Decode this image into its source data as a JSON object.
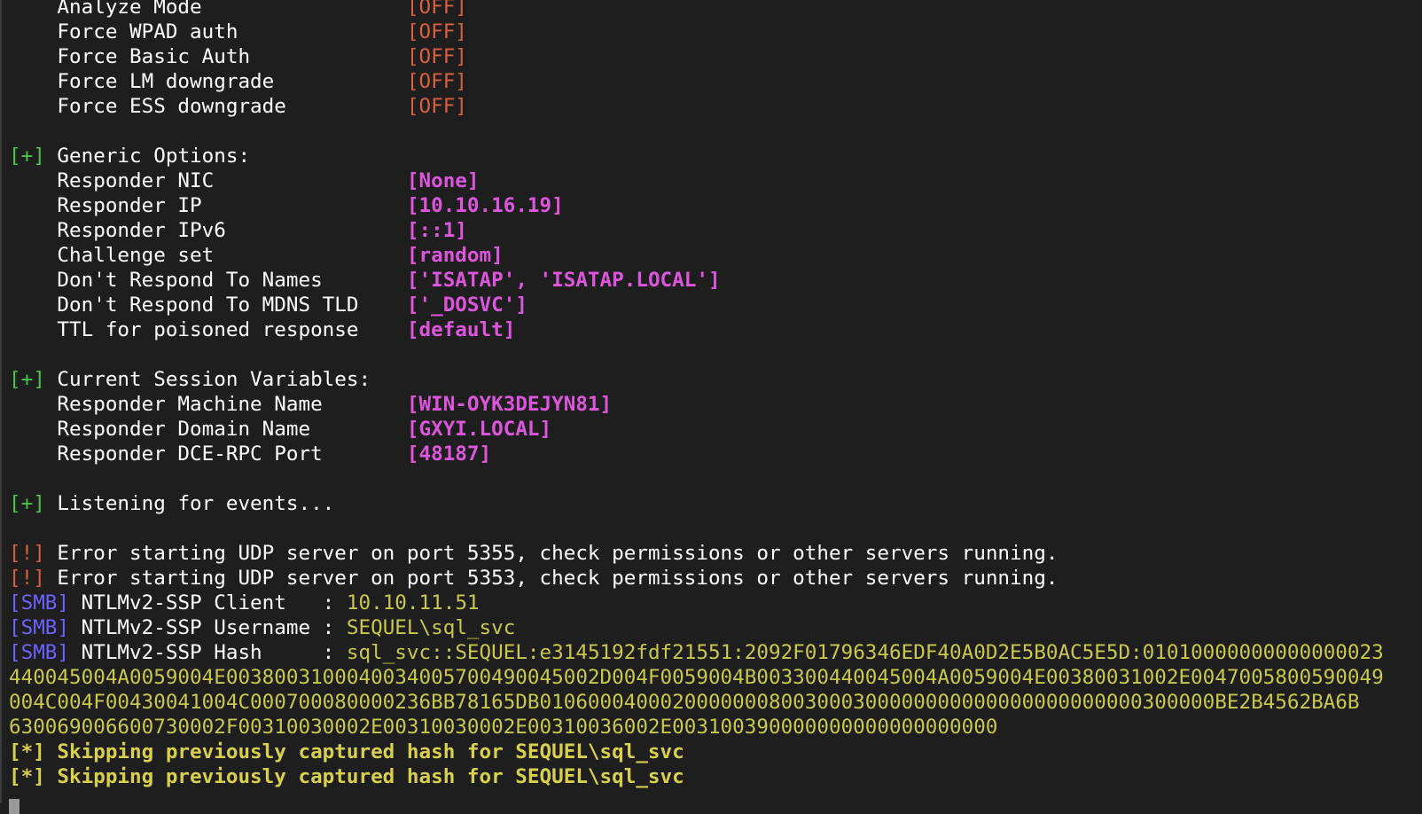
{
  "terminal": {
    "lines": [
      {
        "segments": [
          {
            "text": "    Analyze Mode                 ",
            "color": "white"
          },
          {
            "text": "[OFF]",
            "color": "red"
          }
        ]
      },
      {
        "segments": [
          {
            "text": "    Force WPAD auth              ",
            "color": "white"
          },
          {
            "text": "[OFF]",
            "color": "red"
          }
        ]
      },
      {
        "segments": [
          {
            "text": "    Force Basic Auth             ",
            "color": "white"
          },
          {
            "text": "[OFF]",
            "color": "red"
          }
        ]
      },
      {
        "segments": [
          {
            "text": "    Force LM downgrade           ",
            "color": "white"
          },
          {
            "text": "[OFF]",
            "color": "red"
          }
        ]
      },
      {
        "segments": [
          {
            "text": "    Force ESS downgrade          ",
            "color": "white"
          },
          {
            "text": "[OFF]",
            "color": "red"
          }
        ]
      },
      {
        "segments": []
      },
      {
        "segments": [
          {
            "text": "[+]",
            "color": "green"
          },
          {
            "text": " Generic Options:",
            "color": "white"
          }
        ]
      },
      {
        "segments": [
          {
            "text": "    Responder NIC                ",
            "color": "white"
          },
          {
            "text": "[None]",
            "color": "magenta"
          }
        ]
      },
      {
        "segments": [
          {
            "text": "    Responder IP                 ",
            "color": "white"
          },
          {
            "text": "[10.10.16.19]",
            "color": "magenta"
          }
        ]
      },
      {
        "segments": [
          {
            "text": "    Responder IPv6               ",
            "color": "white"
          },
          {
            "text": "[::1]",
            "color": "magenta"
          }
        ]
      },
      {
        "segments": [
          {
            "text": "    Challenge set                ",
            "color": "white"
          },
          {
            "text": "[random]",
            "color": "magenta"
          }
        ]
      },
      {
        "segments": [
          {
            "text": "    Don't Respond To Names       ",
            "color": "white"
          },
          {
            "text": "['ISATAP', 'ISATAP.LOCAL']",
            "color": "magenta"
          }
        ]
      },
      {
        "segments": [
          {
            "text": "    Don't Respond To MDNS TLD    ",
            "color": "white"
          },
          {
            "text": "['_DOSVC']",
            "color": "magenta"
          }
        ]
      },
      {
        "segments": [
          {
            "text": "    TTL for poisoned response    ",
            "color": "white"
          },
          {
            "text": "[default]",
            "color": "magenta"
          }
        ]
      },
      {
        "segments": []
      },
      {
        "segments": [
          {
            "text": "[+]",
            "color": "green"
          },
          {
            "text": " Current Session Variables:",
            "color": "white"
          }
        ]
      },
      {
        "segments": [
          {
            "text": "    Responder Machine Name       ",
            "color": "white"
          },
          {
            "text": "[WIN-OYK3DEJYN81]",
            "color": "magenta"
          }
        ]
      },
      {
        "segments": [
          {
            "text": "    Responder Domain Name        ",
            "color": "white"
          },
          {
            "text": "[GXYI.LOCAL]",
            "color": "magenta"
          }
        ]
      },
      {
        "segments": [
          {
            "text": "    Responder DCE-RPC Port       ",
            "color": "white"
          },
          {
            "text": "[48187]",
            "color": "magenta"
          }
        ]
      },
      {
        "segments": []
      },
      {
        "segments": [
          {
            "text": "[+]",
            "color": "green"
          },
          {
            "text": " Listening for events...",
            "color": "white"
          }
        ]
      },
      {
        "segments": []
      },
      {
        "segments": [
          {
            "text": "[!]",
            "color": "red"
          },
          {
            "text": " Error starting UDP server on port 5355, check permissions or other servers running.",
            "color": "white"
          }
        ]
      },
      {
        "segments": [
          {
            "text": "[!]",
            "color": "red"
          },
          {
            "text": " Error starting UDP server on port 5353, check permissions or other servers running.",
            "color": "white"
          }
        ]
      },
      {
        "segments": [
          {
            "text": "[SMB]",
            "color": "blue"
          },
          {
            "text": " NTLMv2-SSP Client   : ",
            "color": "white"
          },
          {
            "text": "10.10.11.51",
            "color": "yellow"
          }
        ]
      },
      {
        "segments": [
          {
            "text": "[SMB]",
            "color": "blue"
          },
          {
            "text": " NTLMv2-SSP Username : ",
            "color": "white"
          },
          {
            "text": "SEQUEL\\sql_svc",
            "color": "yellow"
          }
        ]
      },
      {
        "segments": [
          {
            "text": "[SMB]",
            "color": "blue"
          },
          {
            "text": " NTLMv2-SSP Hash     : ",
            "color": "white"
          },
          {
            "text": "sql_svc::SEQUEL:e3145192fdf21551:2092F01796346EDF40A0D2E5B0AC5E5D:01010000000000000023",
            "color": "yellow"
          }
        ]
      },
      {
        "segments": [
          {
            "text": "440045004A0059004E0038003100040034005700490045002D004F0059004B003300440045004A0059004E00380031002E0047005800590049",
            "color": "yellow"
          }
        ]
      },
      {
        "segments": [
          {
            "text": "004C004F00430041004C000700080000236BB78165DB01060004000200000008003000300000000000000000000000300000BE2B4562BA6B",
            "color": "yellow"
          }
        ]
      },
      {
        "segments": [
          {
            "text": "630069006600730002F00310030002E00310030002E00310036002E003100390000000000000000000",
            "color": "yellow"
          }
        ]
      },
      {
        "segments": [
          {
            "text": "[*] Skipping previously captured hash for SEQUEL\\sql_svc",
            "color": "byellow"
          }
        ]
      },
      {
        "segments": [
          {
            "text": "[*] Skipping previously captured hash for SEQUEL\\sql_svc",
            "color": "byellow"
          }
        ]
      }
    ],
    "cursor": true
  },
  "colors": {
    "background": "#1e1e1e",
    "white": "#ffffff",
    "red": "#d9603b",
    "green": "#48c848",
    "magenta": "#dd55dd",
    "blue": "#6b63ff",
    "yellow": "#c9c84a",
    "byellow": "#d8d04a"
  }
}
